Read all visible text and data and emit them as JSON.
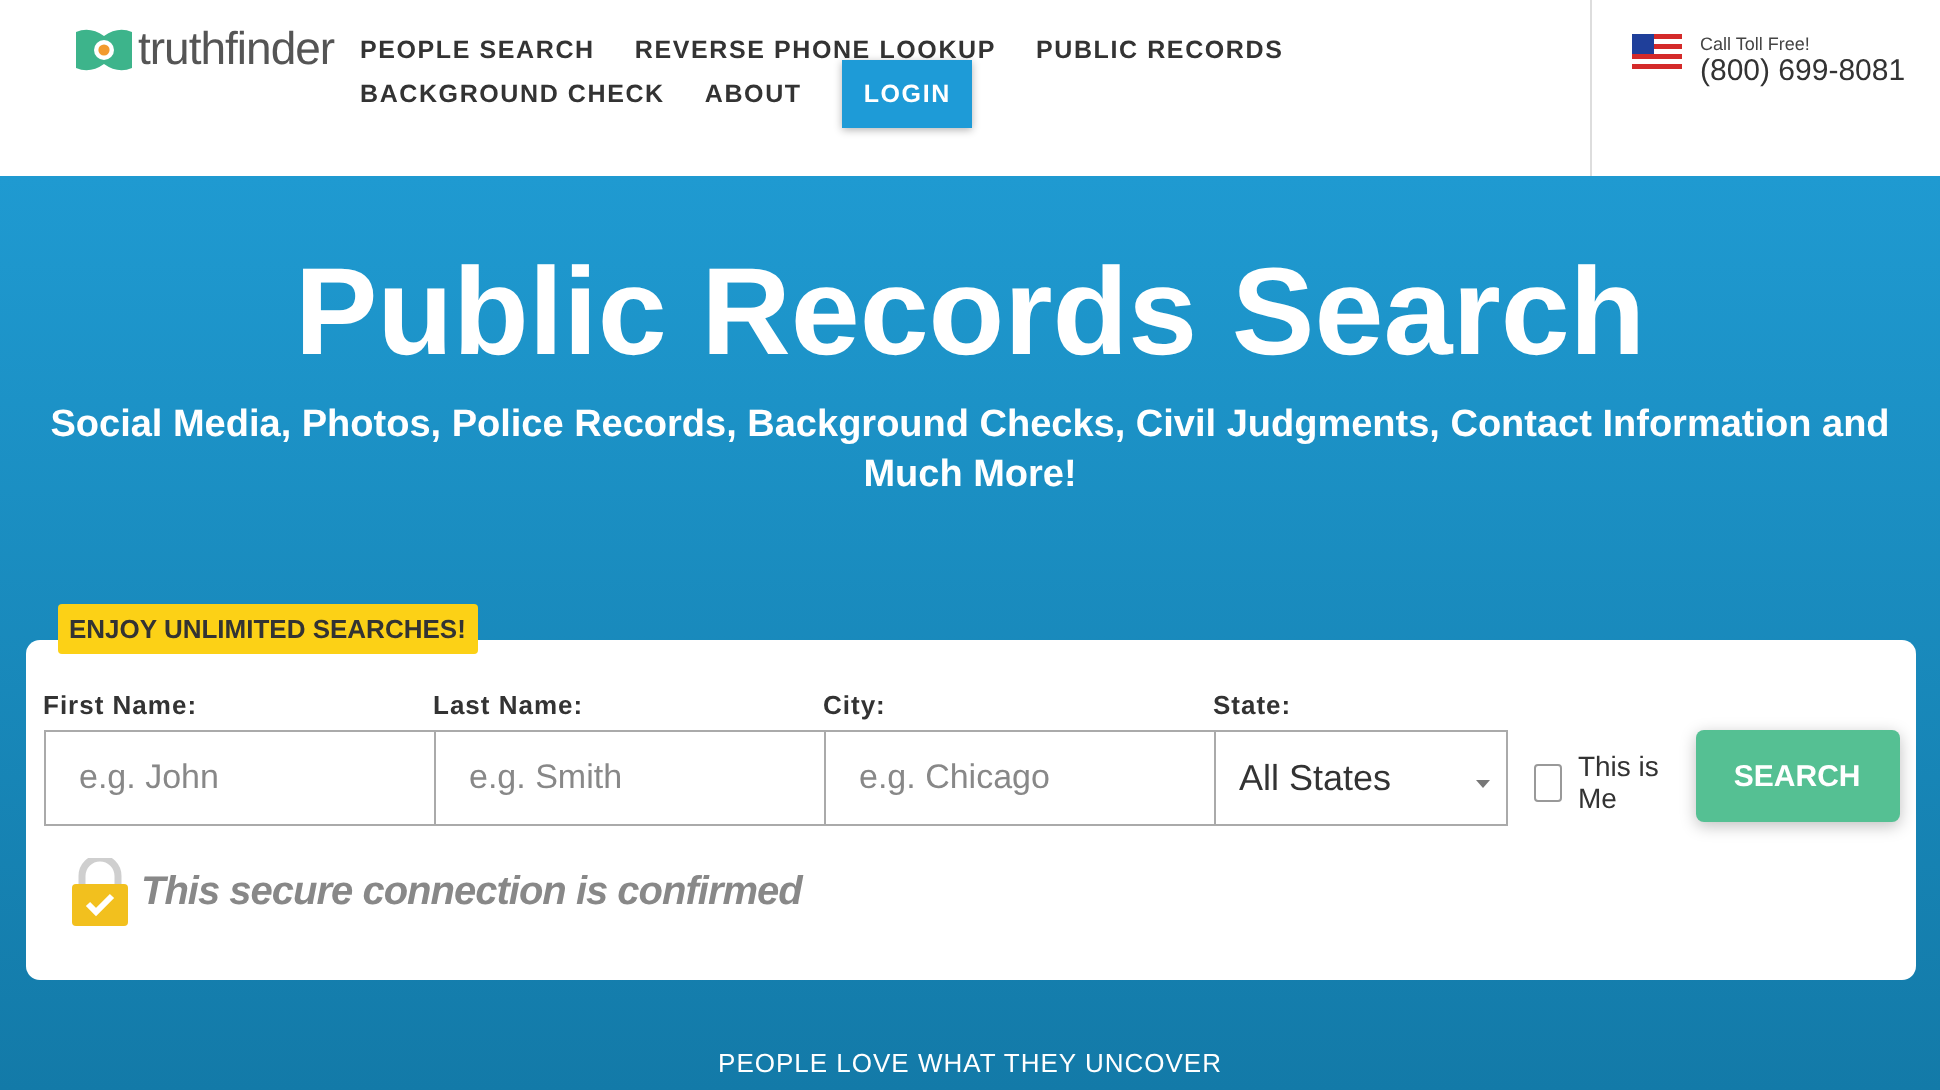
{
  "header": {
    "logo": "truthfinder",
    "nav": [
      {
        "label": "PEOPLE SEARCH",
        "kind": "link"
      },
      {
        "label": "REVERSE PHONE LOOKUP",
        "kind": "link"
      },
      {
        "label": "PUBLIC RECORDS",
        "kind": "link"
      },
      {
        "label": "BACKGROUND CHECK",
        "kind": "link"
      },
      {
        "label": "ABOUT",
        "kind": "link"
      },
      {
        "label": "LOGIN",
        "kind": "button"
      }
    ],
    "call": {
      "caption": "Call Toll Free!",
      "phone": "(800) 699-8081"
    }
  },
  "hero": {
    "title": "Public Records Search",
    "subtitle": "Social Media, Photos, Police Records, Background Checks, Civil Judgments, Contact Information and Much More!"
  },
  "search_form": {
    "badge": "ENJOY UNLIMITED SEARCHES!",
    "fields": [
      {
        "label": "First Name:",
        "placeholder": "e.g. John",
        "kind": "text"
      },
      {
        "label": "Last Name:",
        "placeholder": "e.g. Smith",
        "kind": "text"
      },
      {
        "label": "City:",
        "placeholder": "e.g. Chicago",
        "kind": "text"
      },
      {
        "label": "State:",
        "value": "All States",
        "kind": "select"
      }
    ],
    "this_is_me": {
      "label": "This is Me",
      "checked": false
    },
    "button": "SEARCH",
    "secure_note": "This secure connection is confirmed"
  },
  "footer_heading": "PEOPLE LOVE WHAT THEY UNCOVER"
}
